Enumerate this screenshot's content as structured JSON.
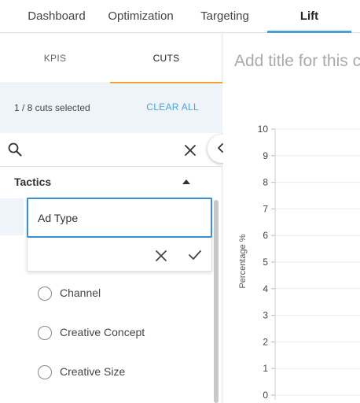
{
  "top_tabs": [
    {
      "label": "Dashboard"
    },
    {
      "label": "Optimization"
    },
    {
      "label": "Targeting"
    },
    {
      "label": "Lift"
    }
  ],
  "colors": {
    "accent_blue": "#4a9fd8",
    "accent_orange": "#f0a030",
    "highlight_bg": "#eef4fa"
  },
  "left_panel": {
    "sub_tabs": [
      {
        "label": "KPIS"
      },
      {
        "label": "CUTS"
      }
    ],
    "selection_count": "1 / 8 cuts selected",
    "clear_all": "CLEAR ALL",
    "search": {
      "placeholder": "",
      "value": ""
    },
    "group": {
      "title": "Tactics"
    },
    "edit": {
      "value": "Ad Type"
    },
    "options": [
      {
        "label": "Channel"
      },
      {
        "label": "Creative Concept"
      },
      {
        "label": "Creative Size"
      }
    ]
  },
  "chart": {
    "title_placeholder": "Add title for this c"
  },
  "chart_data": {
    "type": "bar",
    "title": "",
    "xlabel": "",
    "ylabel": "Percentage %",
    "ylim": [
      0,
      10
    ],
    "yticks": [
      "10",
      "9",
      "8",
      "7",
      "6",
      "5",
      "4",
      "3",
      "2",
      "1",
      "0"
    ],
    "grid": true,
    "series": []
  }
}
